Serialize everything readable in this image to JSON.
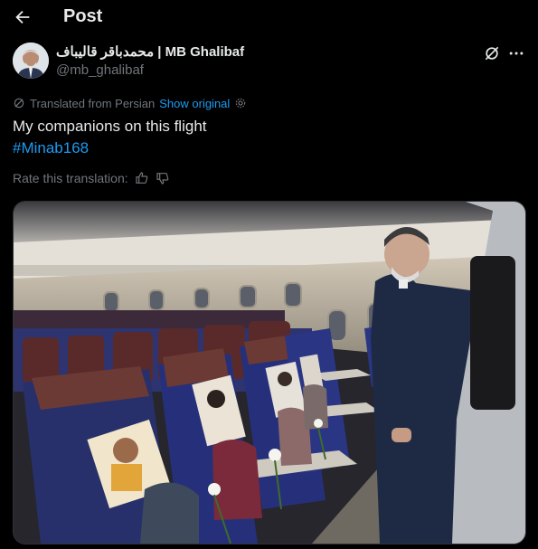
{
  "header": {
    "title": "Post"
  },
  "author": {
    "display_name": "محمدباقر قالیباف | MB Ghalibaf",
    "handle": "@mb_ghalibaf"
  },
  "translation": {
    "notice": "Translated from Persian",
    "show_original": "Show original"
  },
  "post": {
    "text": "My companions on this flight",
    "hashtag": "#Minab168"
  },
  "rating": {
    "label": "Rate this translation:"
  },
  "icons": {
    "back": "arrow-left-icon",
    "grok": "grok-icon",
    "more": "more-options-icon",
    "translate": "translate-icon",
    "settings": "gear-icon",
    "thumbs_up": "thumbs-up-icon",
    "thumbs_down": "thumbs-down-icon"
  },
  "colors": {
    "background": "#000000",
    "text": "#e7e9ea",
    "muted": "#71767b",
    "link": "#1d9bf0"
  }
}
